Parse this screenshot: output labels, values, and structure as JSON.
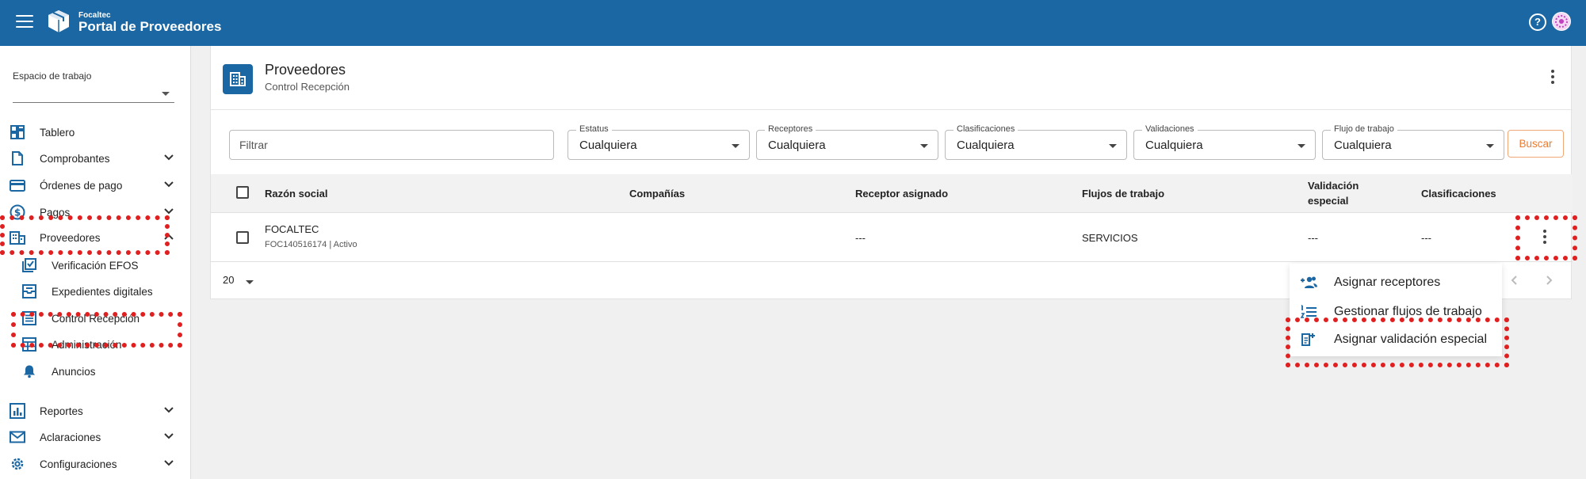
{
  "header": {
    "brand_small": "Focaltec",
    "brand_big": "Portal de Proveedores",
    "help_symbol": "?"
  },
  "sidebar": {
    "workspace_label": "Espacio de trabajo",
    "items": [
      {
        "label": "Tablero",
        "icon": "dashboard-icon"
      },
      {
        "label": "Comprobantes",
        "icon": "document-icon"
      },
      {
        "label": "Órdenes de pago",
        "icon": "card-icon"
      },
      {
        "label": "Pagos",
        "icon": "dollar-icon"
      },
      {
        "label": "Proveedores",
        "icon": "building-icon"
      },
      {
        "label": "Reportes",
        "icon": "chart-icon"
      },
      {
        "label": "Aclaraciones",
        "icon": "mail-icon"
      },
      {
        "label": "Configuraciones",
        "icon": "gear-icon"
      }
    ],
    "subitems": [
      {
        "label": "Verificación EFOS"
      },
      {
        "label": "Expedientes digitales"
      },
      {
        "label": "Control Recepción"
      },
      {
        "label": "Administración"
      },
      {
        "label": "Anuncios"
      }
    ]
  },
  "page": {
    "title": "Proveedores",
    "subtitle": "Control Recepción"
  },
  "filters": {
    "filter_placeholder": "Filtrar",
    "selects": [
      {
        "label": "Estatus",
        "value": "Cualquiera"
      },
      {
        "label": "Receptores",
        "value": "Cualquiera"
      },
      {
        "label": "Clasificaciones",
        "value": "Cualquiera"
      },
      {
        "label": "Validaciones",
        "value": "Cualquiera"
      },
      {
        "label": "Flujo de trabajo",
        "value": "Cualquiera"
      }
    ],
    "search_label": "Buscar"
  },
  "table": {
    "headers": {
      "razon_social": "Razón social",
      "companias": "Compañías",
      "receptor": "Receptor asignado",
      "flujos": "Flujos de trabajo",
      "validacion_1": "Validación",
      "validacion_2": "especial",
      "clasificaciones": "Clasificaciones"
    },
    "rows": [
      {
        "name": "FOCALTEC",
        "detail": "FOC140516174 | Activo",
        "companias": "",
        "receptor": "---",
        "flujos": "SERVICIOS",
        "validacion": "---",
        "clasificaciones": "---"
      }
    ]
  },
  "pagination": {
    "page_size": "20"
  },
  "context_menu": {
    "items": [
      {
        "label": "Asignar receptores",
        "icon": "group-add-icon"
      },
      {
        "label": "Gestionar flujos de trabajo",
        "icon": "list-numbered-icon"
      },
      {
        "label": "Asignar validación especial",
        "icon": "note-add-icon"
      }
    ]
  },
  "colors": {
    "primary": "#1b67a3",
    "accent": "#ee7a2e",
    "highlight": "#e02020"
  }
}
